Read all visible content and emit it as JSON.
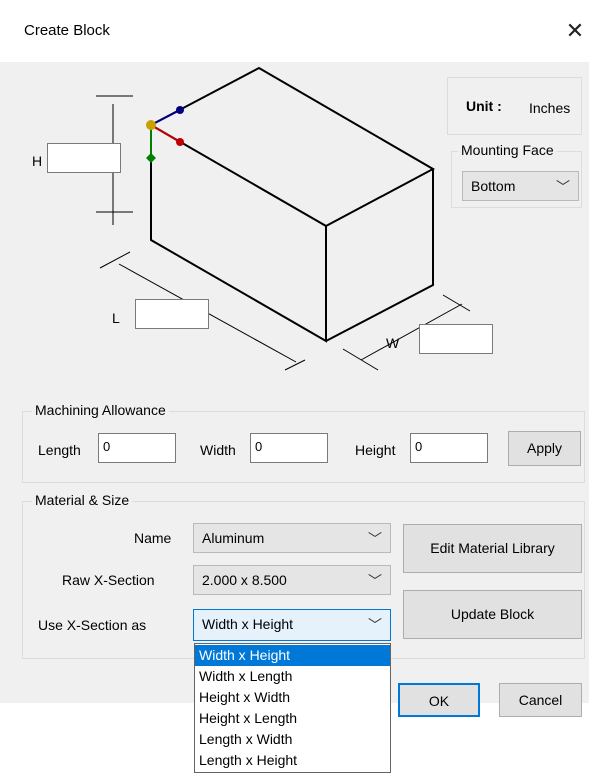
{
  "window": {
    "title": "Create Block",
    "close_glyph": "✕"
  },
  "dimensions": {
    "h_label": "H",
    "l_label": "L",
    "w_label": "W",
    "h_value": "",
    "l_value": "",
    "w_value": ""
  },
  "unit": {
    "label": "Unit :",
    "value": "Inches"
  },
  "mounting_face": {
    "title": "Mounting Face",
    "selected": "Bottom"
  },
  "machining": {
    "title": "Machining Allowance",
    "length_label": "Length",
    "length_value": "0",
    "width_label": "Width",
    "width_value": "0",
    "height_label": "Height",
    "height_value": "0",
    "apply_label": "Apply"
  },
  "material": {
    "title": "Material & Size",
    "name_label": "Name",
    "name_value": "Aluminum",
    "raw_label": "Raw X-Section",
    "raw_value": "2.000 x 8.500",
    "use_label": "Use X-Section as",
    "use_value": "Width x Height",
    "edit_library_label": "Edit Material Library",
    "update_block_label": "Update Block"
  },
  "dropdown_options": [
    "Width x Height",
    "Width x Length",
    "Height x Width",
    "Height x Length",
    "Length x Width",
    "Length x Height"
  ],
  "footer": {
    "ok_label": "OK",
    "cancel_label": "Cancel"
  },
  "icons": {
    "chevron": "chevron-down-icon"
  },
  "colors": {
    "selection": "#0078d7",
    "axis_x": "#c00000",
    "axis_y": "#008000",
    "axis_z": "#000080"
  }
}
